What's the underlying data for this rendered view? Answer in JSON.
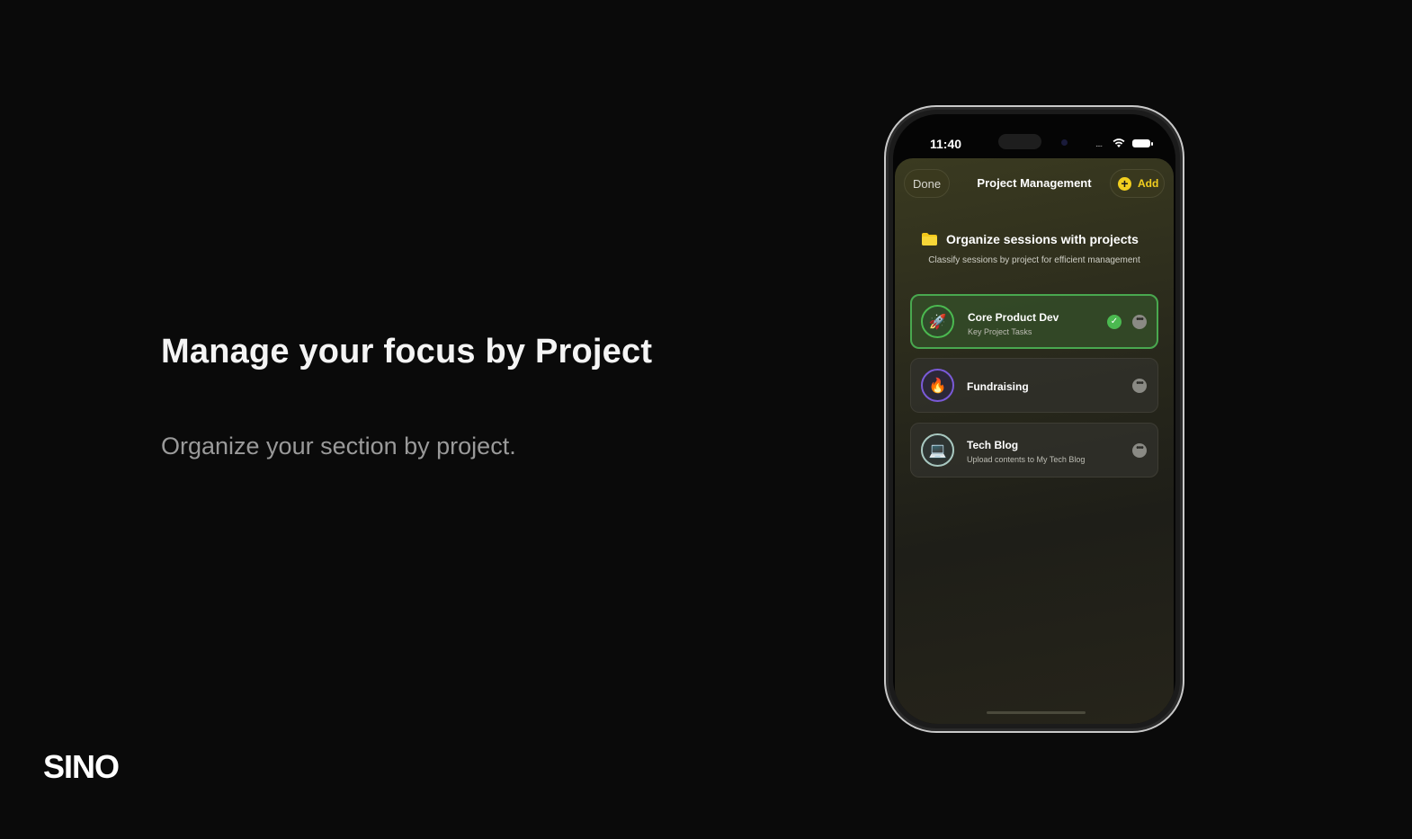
{
  "slide": {
    "headline": "Manage your focus by Project",
    "subline": "Organize your section by project.",
    "brand": "SINO"
  },
  "status_bar": {
    "time": "11:40",
    "signal": "....",
    "icons": [
      "wifi-icon",
      "battery-icon"
    ]
  },
  "nav": {
    "done_label": "Done",
    "title": "Project Management",
    "add_label": "Add",
    "add_icon": "+"
  },
  "intro": {
    "icon": "folder-icon",
    "title": "Organize sessions with projects",
    "description": "Classify sessions by project for efficient management"
  },
  "projects": [
    {
      "name": "Core Product Dev",
      "subtitle": "Key Project Tasks",
      "icon": "🚀",
      "icon_name": "rocket-icon",
      "ring_color": "#4bb950",
      "selected": true,
      "check": "✓",
      "more": "•••"
    },
    {
      "name": "Fundraising",
      "subtitle": "",
      "icon": "🔥",
      "icon_name": "fire-icon",
      "ring_color": "#7a5ad8",
      "selected": false,
      "more": "•••"
    },
    {
      "name": "Tech Blog",
      "subtitle": "Upload contents to My Tech Blog",
      "icon": "💻",
      "icon_name": "laptop-icon",
      "ring_color": "#a8c8c0",
      "selected": false,
      "more": "•••"
    }
  ],
  "colors": {
    "accent_yellow": "#f2cf1f",
    "selected_green": "#4bb950",
    "background": "#0a0a0a"
  }
}
